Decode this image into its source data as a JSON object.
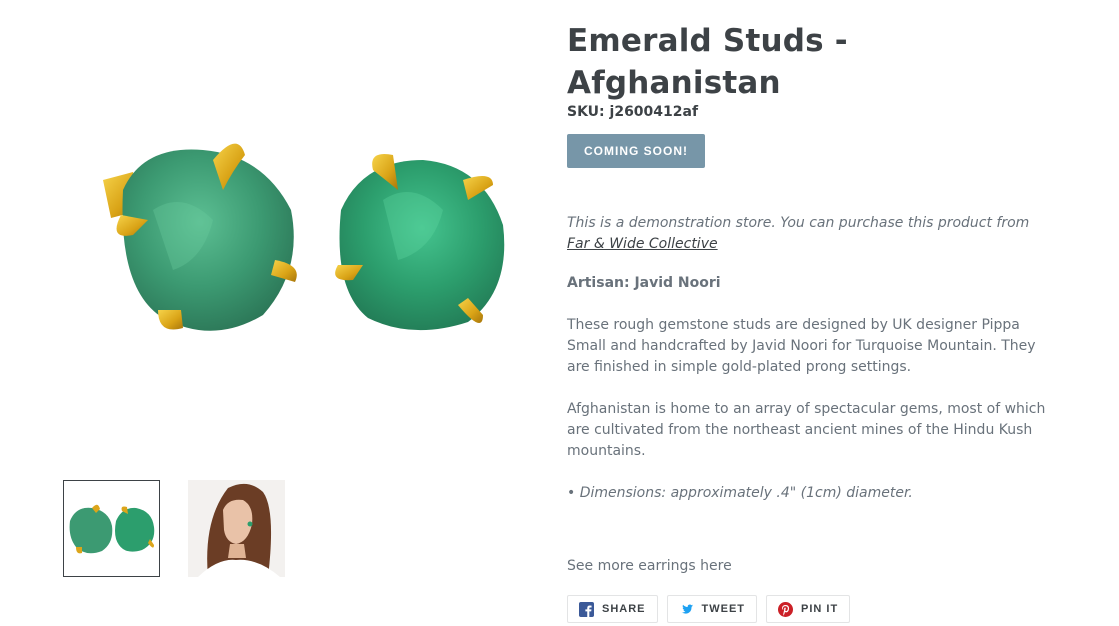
{
  "product": {
    "title": "Emerald Studs - Afghanistan",
    "sku": "SKU: j2600412af",
    "button_label": "COMING SOON!"
  },
  "description": {
    "demo_prefix": "This is a demonstration store. You can purchase this product from",
    "demo_link": "Far & Wide Collective",
    "artisan": "Artisan: Javid Noori",
    "para1": "These rough gemstone studs are designed by UK designer Pippa Small and handcrafted by Javid Noori for Turquoise Mountain. They are finished in simple gold-plated prong settings.",
    "para2": "Afghanistan is home to an array of spectacular gems, most of which are cultivated from the northeast ancient mines of the Hindu Kush mountains.",
    "dimensions": "• Dimensions: approximately .4\" (1cm) diameter.",
    "see_more": "See more earrings here"
  },
  "share": {
    "facebook": "SHARE",
    "twitter": "TWEET",
    "pinterest": "PIN IT"
  },
  "colors": {
    "accent": "#7796a8",
    "heading": "#3d4246",
    "text": "#69727b",
    "facebook": "#3b5998",
    "twitter": "#1da1f2",
    "pinterest": "#cb2027"
  }
}
